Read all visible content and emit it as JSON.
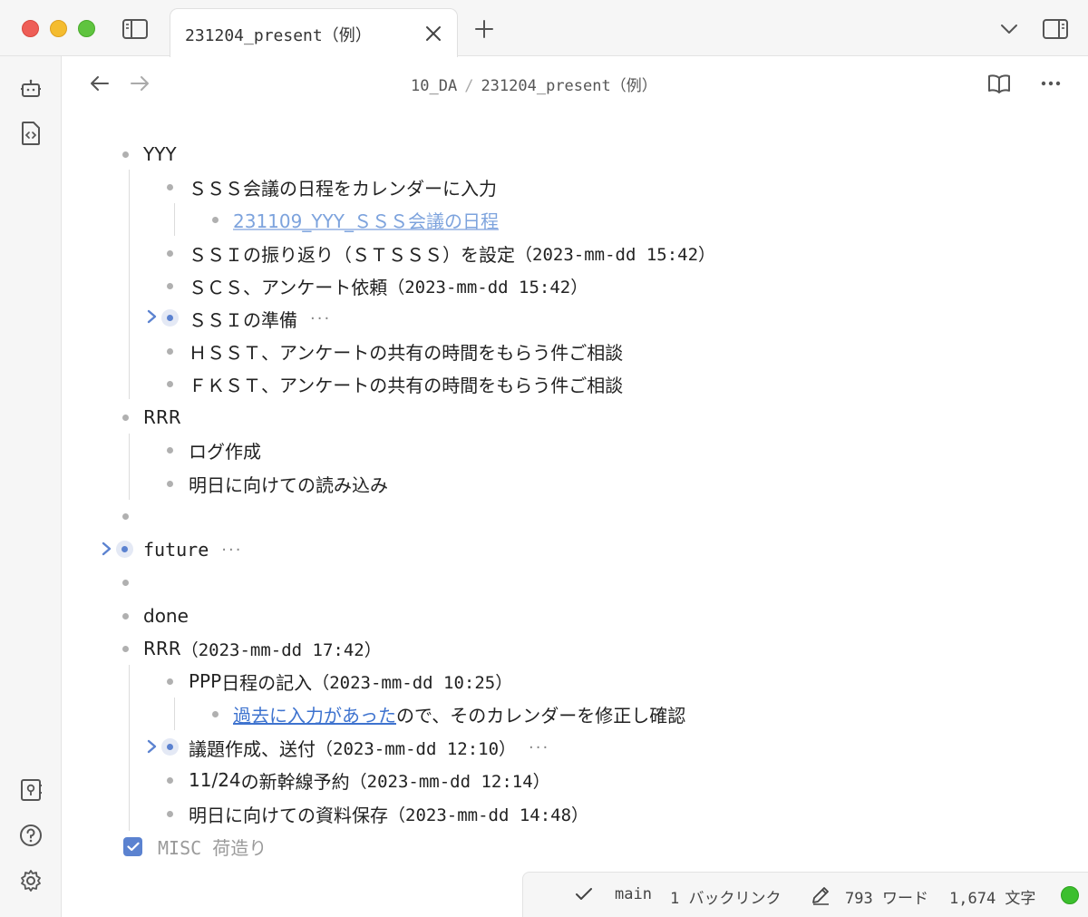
{
  "tab": {
    "title": "231204_present（例）"
  },
  "breadcrumb": {
    "folder": "10_DA",
    "separator": "/",
    "file": "231204_present（例）"
  },
  "outline": {
    "yyy": "YYY",
    "yyy_1": "ＳＳＳ会議の日程をカレンダーに入力",
    "yyy_1_link": "231109_YYY_ＳＳＳ会議の日程",
    "yyy_2": "ＳＳＩの振り返り（ＳＴＳＳＳ）を設定",
    "yyy_2_ts": "（2023-mm-dd 15:42）",
    "yyy_3": "ＳＣＳ、アンケート依頼",
    "yyy_3_ts": "（2023-mm-dd 15:42）",
    "yyy_4": "ＳＳＩの準備",
    "yyy_5": "ＨＳＳＴ、アンケートの共有の時間をもらう件ご相談",
    "yyy_6": "ＦＫＳＴ、アンケートの共有の時間をもらう件ご相談",
    "rrr": "RRR",
    "rrr_1": "ログ作成",
    "rrr_2": "明日に向けての読み込み",
    "future": "future",
    "done": "done",
    "rrr2": "RRR",
    "rrr2_ts": "（2023-mm-dd 17:42）",
    "rrr2_1_prefix": "PPP",
    "rrr2_1": "日程の記入",
    "rrr2_1_ts": "（2023-mm-dd 10:25）",
    "rrr2_1_1_link": "過去に入力があった",
    "rrr2_1_1_rest": "ので、そのカレンダーを修正し確認",
    "rrr2_2": "議題作成、送付",
    "rrr2_2_ts": "（2023-mm-dd 12:10）",
    "rrr2_3_prefix": "11/24",
    "rrr2_3": "の新幹線予約",
    "rrr2_3_ts": "（2023-mm-dd 12:14）",
    "rrr2_4": "明日に向けての資料保存",
    "rrr2_4_ts": "（2023-mm-dd 14:48）",
    "misc": "MISC 荷造り",
    "more_dots": "···"
  },
  "status": {
    "branch": "main",
    "backlinks": "1 バックリンク",
    "words": "793 ワード",
    "chars": "1,674 文字"
  },
  "colors": {
    "accent": "#5b82d0",
    "link": "#3e73cf",
    "sync_ok": "#3cbf2e"
  }
}
